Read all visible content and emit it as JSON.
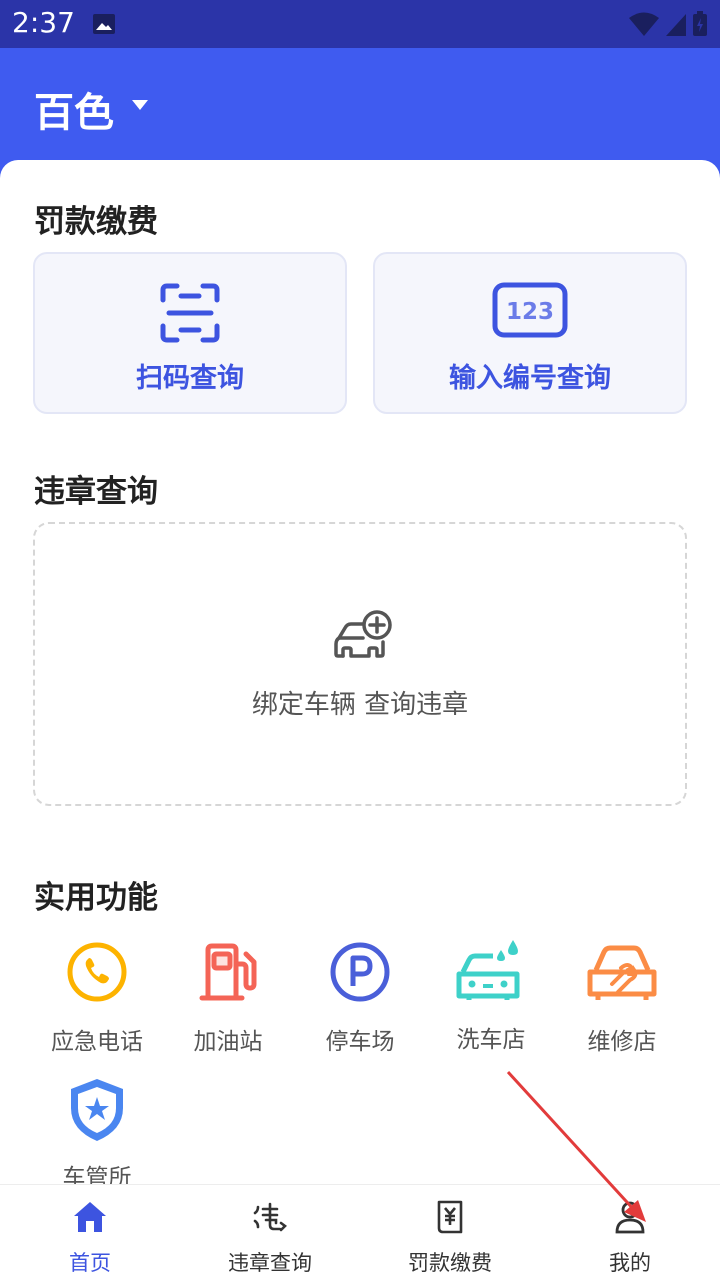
{
  "status_bar": {
    "time": "2:37"
  },
  "header": {
    "city": "百色"
  },
  "fines_section": {
    "title": "罚款缴费",
    "scan_label": "扫码查询",
    "number_label": "输入编号查询",
    "number_icon_text": "123"
  },
  "violation_section": {
    "title": "违章查询",
    "bind_label": "绑定车辆 查询违章"
  },
  "tools_section": {
    "title": "实用功能",
    "items": [
      {
        "label": "应急电话",
        "icon": "phone-icon",
        "color": "#fdb300"
      },
      {
        "label": "加油站",
        "icon": "fuel-pump-icon",
        "color": "#f46456"
      },
      {
        "label": "停车场",
        "icon": "parking-icon",
        "color": "#4a5fd9"
      },
      {
        "label": "洗车店",
        "icon": "car-wash-icon",
        "color": "#3ed1c9"
      },
      {
        "label": "维修店",
        "icon": "car-repair-icon",
        "color": "#fb8c45"
      },
      {
        "label": "车管所",
        "icon": "shield-star-icon",
        "color": "#4a86f0"
      }
    ]
  },
  "tab_bar": {
    "items": [
      {
        "label": "首页",
        "icon": "home-icon",
        "active": true
      },
      {
        "label": "违章查询",
        "icon": "violation-icon",
        "active": false
      },
      {
        "label": "罚款缴费",
        "icon": "fine-receipt-icon",
        "active": false
      },
      {
        "label": "我的",
        "icon": "user-icon",
        "active": false
      }
    ]
  },
  "colors": {
    "brand": "#3f5bf0",
    "status_bar": "#2b34a8",
    "accent_text": "#3d54e0",
    "annotation_arrow": "#e23b3b"
  }
}
